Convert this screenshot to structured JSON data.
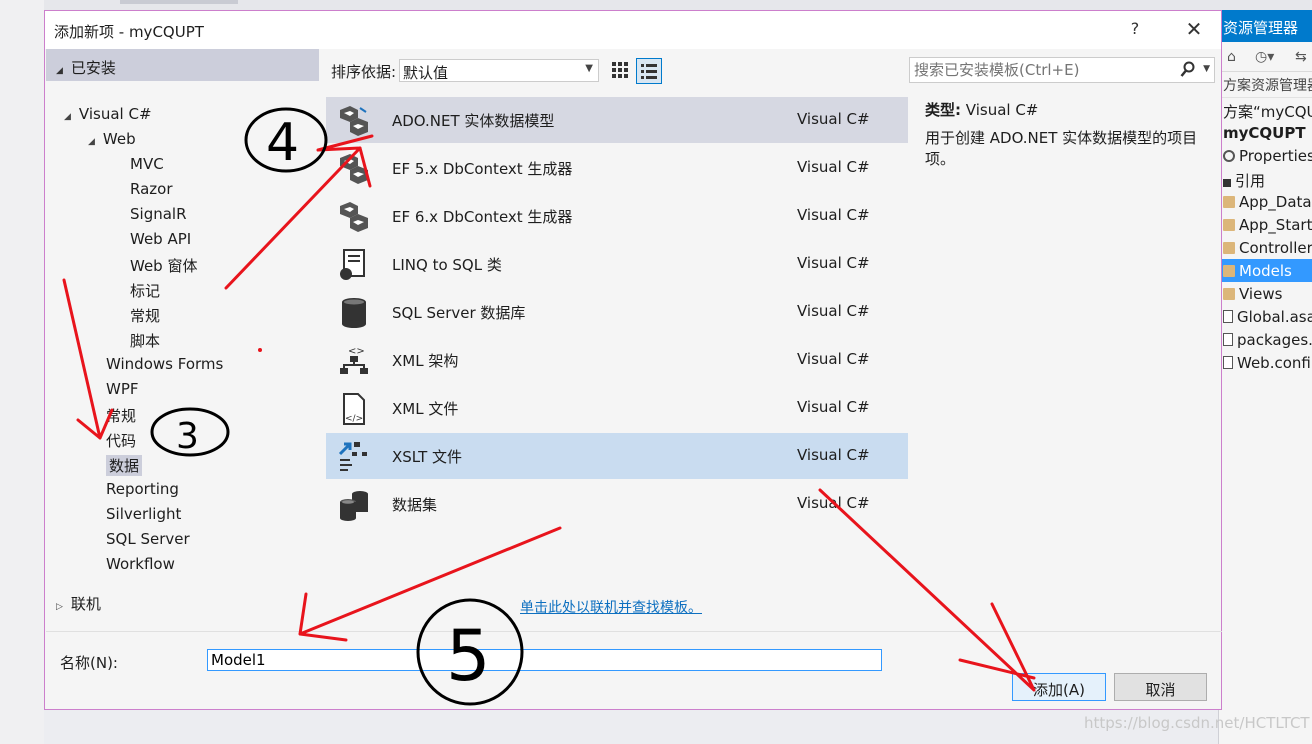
{
  "dialog": {
    "title": "添加新项 - myCQUPT",
    "help": "?",
    "close": "✕"
  },
  "tree": {
    "installed": "已安装",
    "items": [
      {
        "label": "Visual C#",
        "expanded": true
      },
      {
        "label": "Web",
        "expanded": true
      },
      {
        "label": "MVC"
      },
      {
        "label": "Razor"
      },
      {
        "label": "SignalR"
      },
      {
        "label": "Web API"
      },
      {
        "label": "Web 窗体"
      },
      {
        "label": "标记"
      },
      {
        "label": "常规"
      },
      {
        "label": "脚本"
      },
      {
        "label": "Windows Forms"
      },
      {
        "label": "WPF"
      },
      {
        "label": "常规"
      },
      {
        "label": "代码"
      },
      {
        "label": "数据",
        "selected": true
      },
      {
        "label": "Reporting"
      },
      {
        "label": "Silverlight"
      },
      {
        "label": "SQL Server"
      },
      {
        "label": "Workflow"
      }
    ],
    "online": "联机"
  },
  "sort": {
    "label": "排序依据:",
    "value": "默认值"
  },
  "templates": [
    {
      "name": "ADO.NET 实体数据模型",
      "lang": "Visual C#",
      "icon": "entity-model-icon"
    },
    {
      "name": "EF 5.x DbContext 生成器",
      "lang": "Visual C#",
      "icon": "dbcontext-generator-icon"
    },
    {
      "name": "EF 6.x DbContext 生成器",
      "lang": "Visual C#",
      "icon": "dbcontext-generator-icon"
    },
    {
      "name": "LINQ to SQL 类",
      "lang": "Visual C#",
      "icon": "linq-to-sql-icon"
    },
    {
      "name": "SQL Server 数据库",
      "lang": "Visual C#",
      "icon": "database-icon"
    },
    {
      "name": "XML 架构",
      "lang": "Visual C#",
      "icon": "xml-schema-icon"
    },
    {
      "name": "XML 文件",
      "lang": "Visual C#",
      "icon": "xml-file-icon"
    },
    {
      "name": "XSLT 文件",
      "lang": "Visual C#",
      "icon": "xslt-file-icon"
    },
    {
      "name": "数据集",
      "lang": "Visual C#",
      "icon": "dataset-icon"
    }
  ],
  "online_link": "单击此处以联机并查找模板。",
  "search": {
    "placeholder": "搜索已安装模板(Ctrl+E)"
  },
  "description": {
    "type_label": "类型:",
    "type_value": "Visual C#",
    "text": "用于创建 ADO.NET 实体数据模型的项目项。"
  },
  "name_field": {
    "label": "名称(N):",
    "value": "Model1"
  },
  "buttons": {
    "add": "添加(A)",
    "cancel": "取消"
  },
  "solution_explorer": {
    "title": "资源管理器",
    "search": "方案资源管理器",
    "items": [
      {
        "label": "方案“myCQU",
        "kind": "none"
      },
      {
        "label": "myCQUPT",
        "kind": "bold"
      },
      {
        "label": "Properties",
        "kind": "gear"
      },
      {
        "label": "引用",
        "kind": "ref"
      },
      {
        "label": "App_Data",
        "kind": "folder"
      },
      {
        "label": "App_Start",
        "kind": "folder"
      },
      {
        "label": "Controller",
        "kind": "folder"
      },
      {
        "label": "Models",
        "kind": "folder",
        "selected": true
      },
      {
        "label": "Views",
        "kind": "folder"
      },
      {
        "label": "Global.asa",
        "kind": "file"
      },
      {
        "label": "packages.c",
        "kind": "file"
      },
      {
        "label": "Web.confi",
        "kind": "file"
      }
    ]
  },
  "annotations": {
    "step3": "3",
    "step4": "4",
    "step5": "5",
    "annotation_color": "#e8141c"
  },
  "watermark": "https://blog.csdn.net/HCTLTCT"
}
